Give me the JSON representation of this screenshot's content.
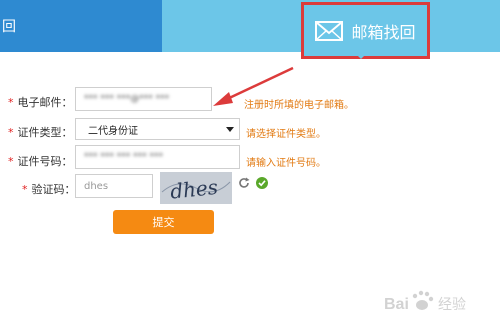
{
  "tabs": {
    "left_label": "回",
    "active_label": "邮箱找回",
    "active_icon": "envelope-icon"
  },
  "form": {
    "email": {
      "label": "电子邮件：",
      "value": "*** *** ***@*** ***",
      "hint": "注册时所填的电子邮箱。"
    },
    "id_type": {
      "label": "证件类型：",
      "value": "二代身份证",
      "hint": "请选择证件类型。"
    },
    "id_number": {
      "label": "证件号码：",
      "value": "*** *** *** *** ***",
      "hint": "请输入证件号码。"
    },
    "captcha": {
      "label": "验证码：",
      "value": "dhes",
      "image_text": "dhes"
    },
    "required_mark": "*",
    "submit_label": "提交"
  },
  "watermark": {
    "text": "Bai 经验"
  },
  "colors": {
    "tab_left": "#2e8ad1",
    "tab_right": "#6cc6e8",
    "highlight": "#dc3b3b",
    "hint": "#e27a12",
    "submit": "#f58a12"
  }
}
